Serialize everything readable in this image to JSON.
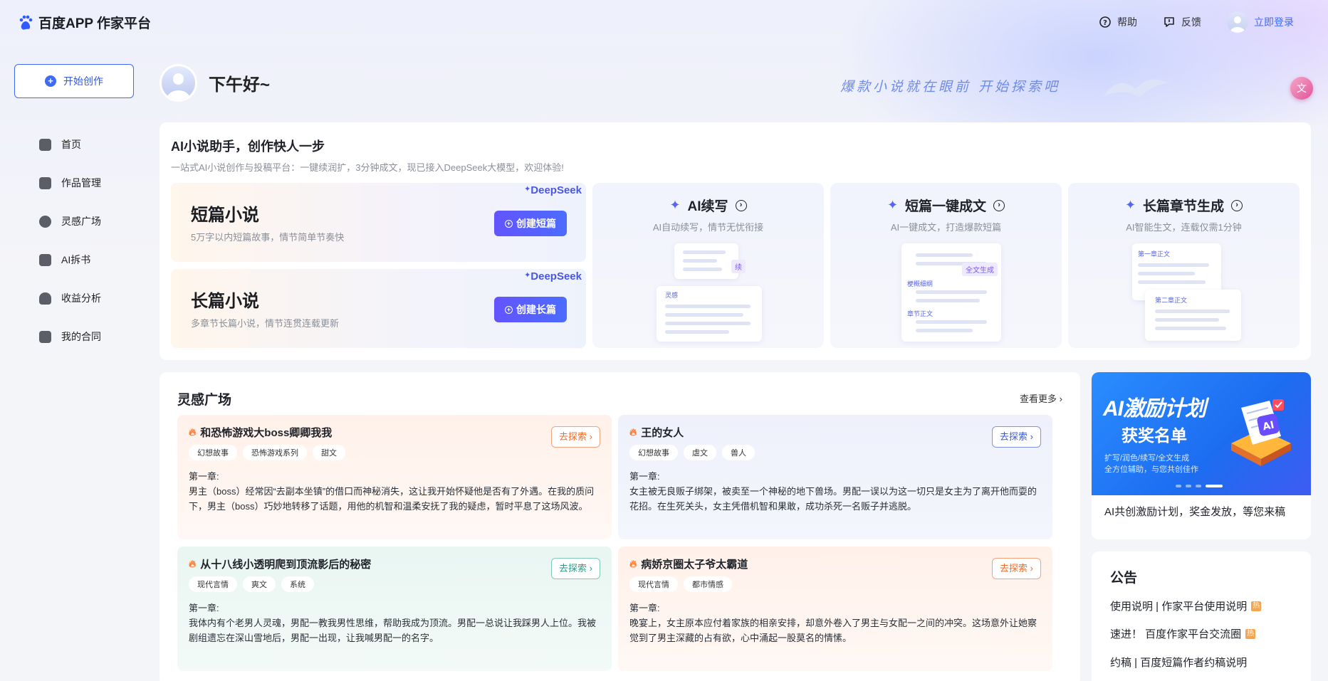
{
  "header": {
    "logo_text": "百度APP 作家平台",
    "help_label": "帮助",
    "feedback_label": "反馈",
    "login_label": "立即登录"
  },
  "sidebar": {
    "create_label": "开始创作",
    "items": [
      {
        "label": "首页",
        "icon": "home-icon"
      },
      {
        "label": "作品管理",
        "icon": "works-icon"
      },
      {
        "label": "灵感广场",
        "icon": "bulb-icon"
      },
      {
        "label": "AI拆书",
        "icon": "ai-book-icon"
      },
      {
        "label": "收益分析",
        "icon": "income-icon"
      },
      {
        "label": "我的合同",
        "icon": "contract-icon"
      }
    ]
  },
  "greeting": {
    "text": "下午好~",
    "slogan": "爆款小说就在眼前 开始探索吧"
  },
  "assistant": {
    "title": "AI小说助手，创作快人一步",
    "subtitle": "一站式AI小说创作与投稿平台：一键续润扩，3分钟成文，现已接入DeepSeek大模型，欢迎体验!",
    "deepseek_label": "DeepSeek",
    "novels": [
      {
        "title": "短篇小说",
        "desc": "5万字以内短篇故事，情节简单节奏快",
        "button": "创建短篇"
      },
      {
        "title": "长篇小说",
        "desc": "多章节长篇小说，情节连贯连载更新",
        "button": "创建长篇"
      }
    ],
    "features": [
      {
        "title": "AI续写",
        "desc": "AI自动续写，情节无忧衔接",
        "mini_tag": "续",
        "mini_label": "灵感"
      },
      {
        "title": "短篇一键成文",
        "desc": "AI一键成文，打造爆款短篇",
        "mini_tag": "全文生成",
        "mini_label": "梗概细纲",
        "mini_label2": "章节正文"
      },
      {
        "title": "长篇章节生成",
        "desc": "AI智能生文，连载仅需1分钟",
        "mini_label": "第一章正文",
        "mini_label2": "第二章正文"
      }
    ]
  },
  "inspiration": {
    "title": "灵感广场",
    "more_label": "查看更多",
    "explore_label": "去探索",
    "cards": [
      {
        "title": "和恐怖游戏大boss卿卿我我",
        "tags": [
          "幻想故事",
          "恐怖游戏系列",
          "甜文"
        ],
        "chapter": "第一章:",
        "body": "男主（boss）经常因“去副本坐镇”的借口而神秘消失，这让我开始怀疑他是否有了外遇。在我的质问下，男主（boss）巧妙地转移了话题，用他的机智和温柔安抚了我的疑虑，暂时平息了这场风波。"
      },
      {
        "title": "王的女人",
        "tags": [
          "幻想故事",
          "虐文",
          "兽人"
        ],
        "chapter": "第一章:",
        "body": "女主被无良贩子绑架，被卖至一个神秘的地下兽场。男配一误以为这一切只是女主为了离开他而耍的花招。在生死关头，女主凭借机智和果敢，成功杀死一名贩子并逃脱。"
      },
      {
        "title": "从十八线小透明爬到顶流影后的秘密",
        "tags": [
          "现代言情",
          "爽文",
          "系统"
        ],
        "chapter": "第一章:",
        "body": "我体内有个老男人灵魂，男配一教我男性思维，帮助我成为顶流。男配一总说让我踩男人上位。我被剧组遗忘在深山雪地后，男配一出现，让我喊男配一的名字。"
      },
      {
        "title": "病娇京圈太子爷太霸道",
        "tags": [
          "现代言情",
          "都市情感"
        ],
        "chapter": "第一章:",
        "body": "晚宴上，女主原本应付着家族的相亲安排，却意外卷入了男主与女配一之间的冲突。这场意外让她察觉到了男主深藏的占有欲，心中涌起一股莫名的情愫。"
      }
    ]
  },
  "promo": {
    "title": "AI激励计划",
    "subtitle": "获奖名单",
    "line1": "扩写/润色/续写/全文生成",
    "line2": "全方位辅助，与您共创佳作",
    "caption": "AI共创激励计划，奖金发放，等您来稿"
  },
  "notice": {
    "title": "公告",
    "hot_label": "热",
    "items": [
      {
        "text": "使用说明 | 作家平台使用说明",
        "hot": true
      },
      {
        "text": "速进！ 百度作家平台交流圈",
        "hot": true
      },
      {
        "text": "约稿 | 百度短篇作者约稿说明",
        "hot": false
      }
    ]
  }
}
